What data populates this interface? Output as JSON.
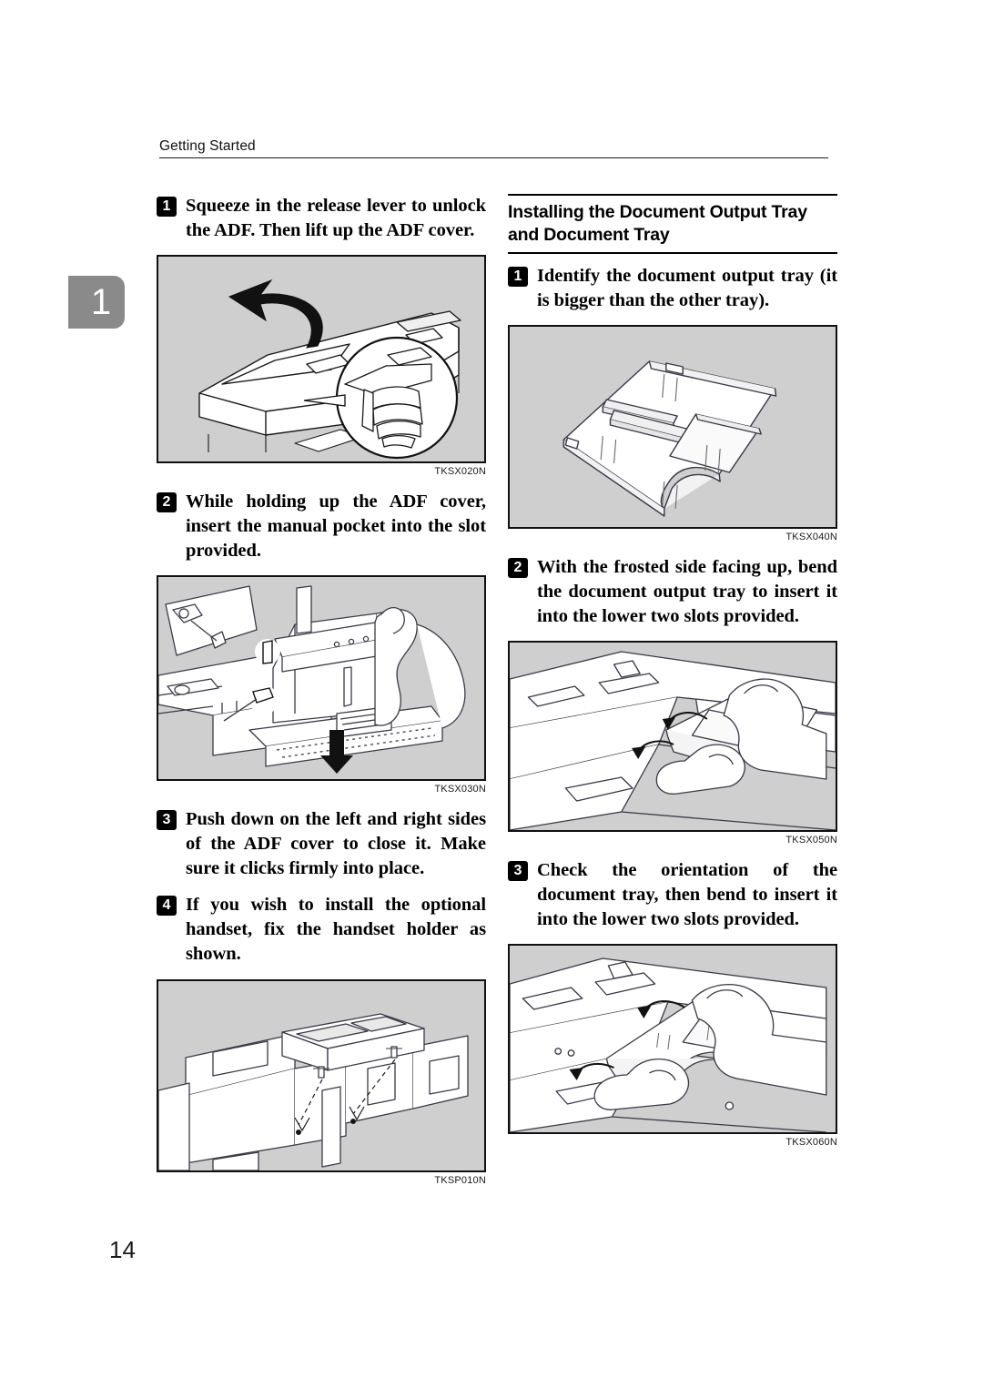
{
  "page": {
    "running_header": "Getting Started",
    "page_number": "14",
    "chapter_tab": "1"
  },
  "left_column": {
    "steps": [
      {
        "number": "1",
        "text": "Squeeze in the release lever to unlock the ADF. Then lift up the ADF cover.",
        "figure": {
          "code": "TKSX020N",
          "alt": "adf-cover-lift-illustration"
        }
      },
      {
        "number": "2",
        "text": "While holding up the ADF cover, insert the manual pocket into the slot provided.",
        "figure": {
          "code": "TKSX030N",
          "alt": "manual-pocket-insert-illustration"
        }
      },
      {
        "number": "3",
        "text": "Push down on the left and right sides of the ADF cover to close it. Make sure it clicks firmly into place.",
        "figure": null
      },
      {
        "number": "4",
        "text": "If you wish to install the optional handset, fix the handset holder as shown.",
        "figure": {
          "code": "TKSP010N",
          "alt": "handset-holder-illustration"
        }
      }
    ]
  },
  "right_column": {
    "section_heading": "Installing the Document Output Tray and Document Tray",
    "steps": [
      {
        "number": "1",
        "text": "Identify the document output tray (it is bigger than the other tray).",
        "figure": {
          "code": "TKSX040N",
          "alt": "document-output-tray-illustration"
        }
      },
      {
        "number": "2",
        "text": "With the frosted side facing up, bend the document output tray to insert it into the lower two slots provided.",
        "figure": {
          "code": "TKSX050N",
          "alt": "bend-output-tray-illustration"
        }
      },
      {
        "number": "3",
        "text": "Check the orientation of the document tray, then bend to insert it into the lower two slots provided.",
        "figure": {
          "code": "TKSX060N",
          "alt": "document-tray-insert-illustration"
        }
      }
    ]
  },
  "colors": {
    "figure_background": "#cfcfcf",
    "figure_border": "#101010",
    "chapter_tab": "#8a8a8a",
    "text": "#000000"
  }
}
